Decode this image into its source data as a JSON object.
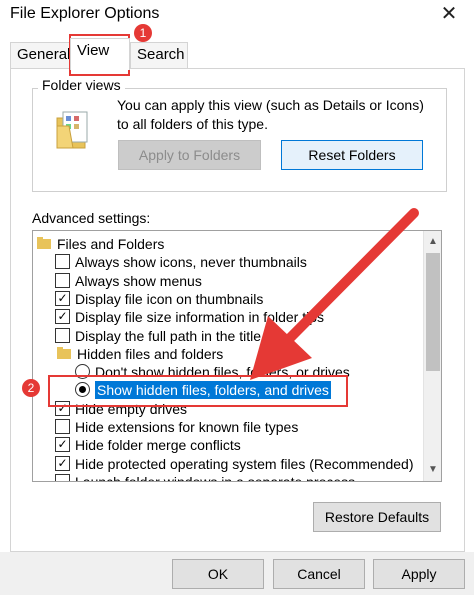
{
  "window": {
    "title": "File Explorer Options",
    "close_glyph": "✕"
  },
  "tabs": [
    {
      "label": "General"
    },
    {
      "label": "View"
    },
    {
      "label": "Search"
    }
  ],
  "folder_views": {
    "title": "Folder views",
    "description": "You can apply this view (such as Details or Icons) to all folders of this type.",
    "apply_label": "Apply to Folders",
    "reset_label": "Reset Folders"
  },
  "advanced": {
    "label": "Advanced settings:",
    "items": [
      {
        "type": "folder",
        "label": "Files and Folders"
      },
      {
        "type": "checkbox",
        "checked": false,
        "label": "Always show icons, never thumbnails"
      },
      {
        "type": "checkbox",
        "checked": false,
        "label": "Always show menus"
      },
      {
        "type": "checkbox",
        "checked": true,
        "label": "Display file icon on thumbnails"
      },
      {
        "type": "checkbox",
        "checked": true,
        "label": "Display file size information in folder tips"
      },
      {
        "type": "checkbox",
        "checked": false,
        "label": "Display the full path in the title bar"
      },
      {
        "type": "folder",
        "label": "Hidden files and folders"
      },
      {
        "type": "radio",
        "checked": false,
        "label": "Don't show hidden files, folders, or drives"
      },
      {
        "type": "radio",
        "checked": true,
        "label": "Show hidden files, folders, and drives"
      },
      {
        "type": "checkbox",
        "checked": true,
        "label": "Hide empty drives"
      },
      {
        "type": "checkbox",
        "checked": false,
        "label": "Hide extensions for known file types"
      },
      {
        "type": "checkbox",
        "checked": true,
        "label": "Hide folder merge conflicts"
      },
      {
        "type": "checkbox",
        "checked": true,
        "label": "Hide protected operating system files (Recommended)"
      },
      {
        "type": "checkbox",
        "checked": false,
        "label": "Launch folder windows in a separate process"
      }
    ]
  },
  "buttons": {
    "restore": "Restore Defaults",
    "ok": "OK",
    "cancel": "Cancel",
    "apply": "Apply"
  },
  "annotations": {
    "badge1": "1",
    "badge2": "2",
    "accent": "#e53935"
  }
}
